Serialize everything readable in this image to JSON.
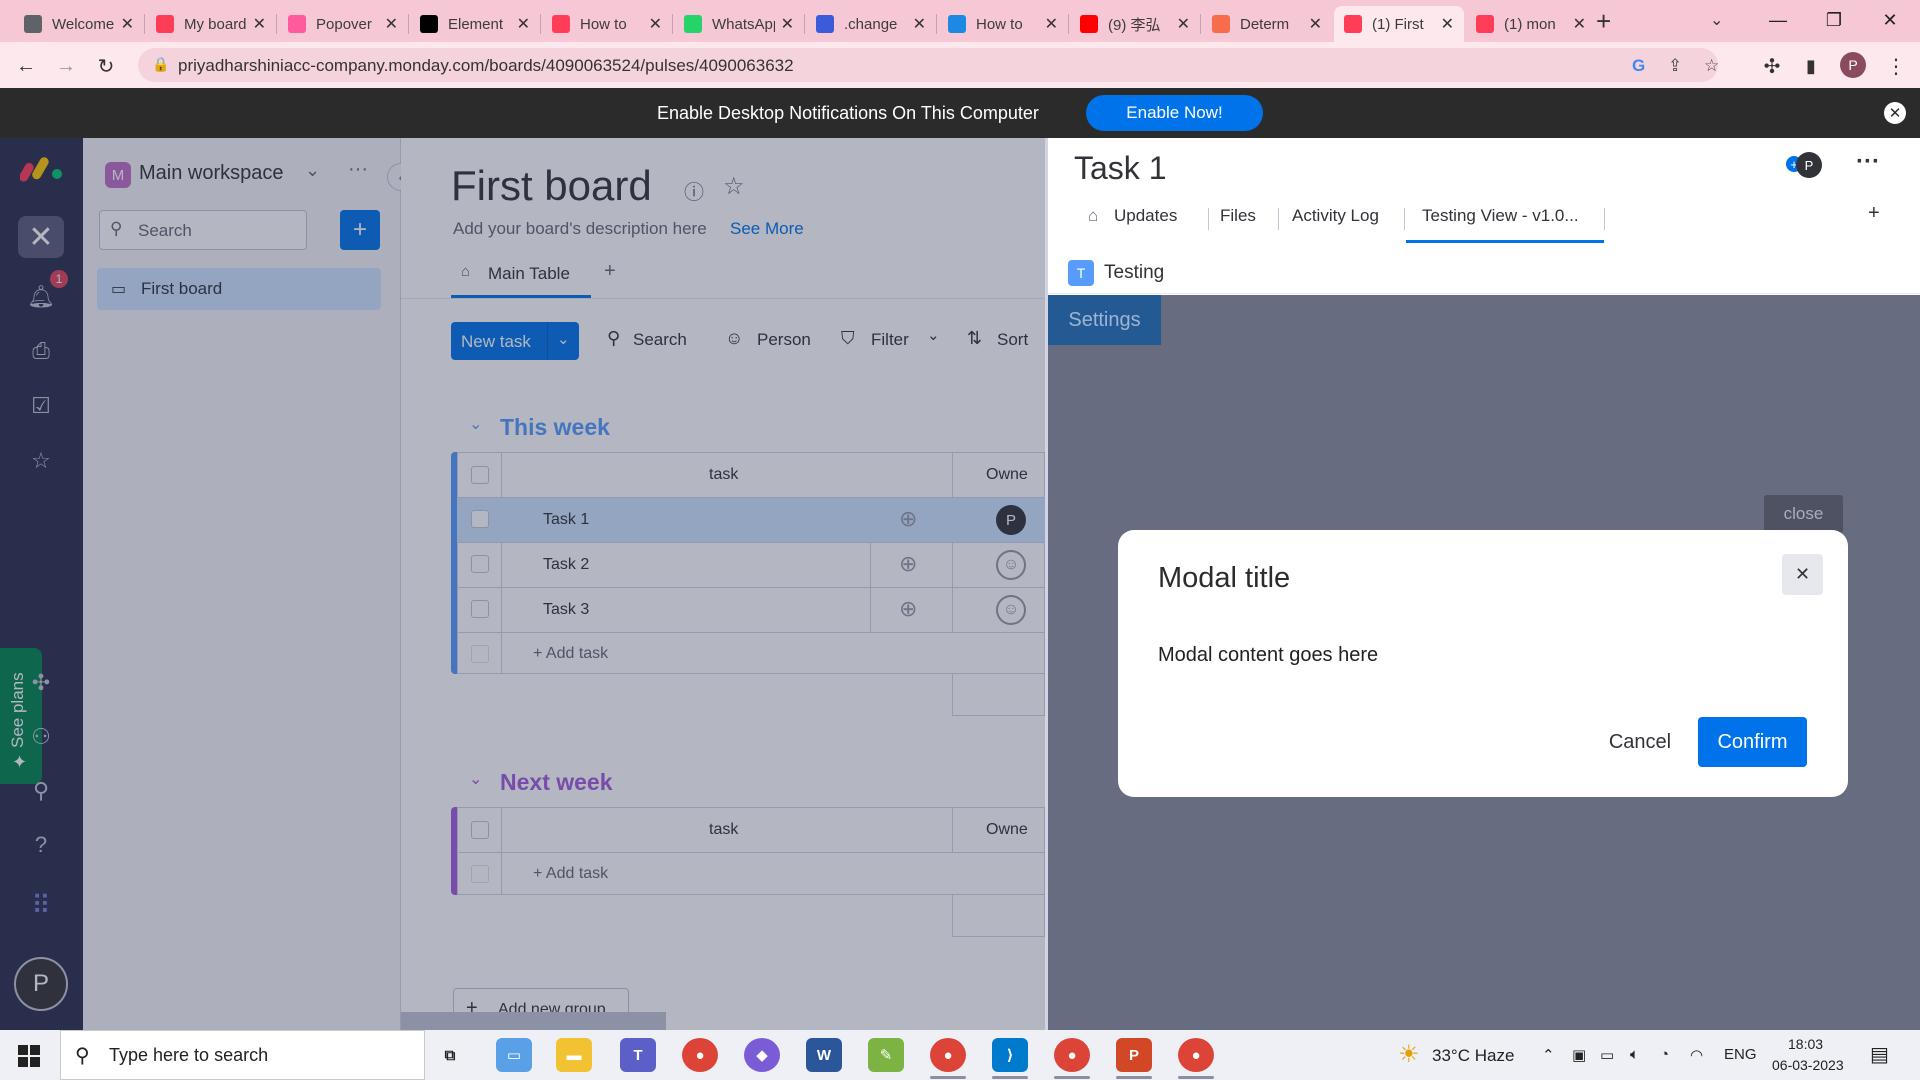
{
  "browser": {
    "tabs": [
      {
        "title": "Welcome",
        "color": "#5f6368"
      },
      {
        "title": "My board",
        "color": "#ff3d57"
      },
      {
        "title": "Popover",
        "color": "#ff5a9a"
      },
      {
        "title": "Element",
        "color": "#000000"
      },
      {
        "title": "How to",
        "color": "#ff3d57"
      },
      {
        "title": "WhatsApp",
        "color": "#25d366"
      },
      {
        "title": ".change",
        "color": "#3b5bdb"
      },
      {
        "title": "How to",
        "color": "#1e88e5"
      },
      {
        "title": "(9) 李弘",
        "color": "#ff0000"
      },
      {
        "title": "Determ",
        "color": "#f76c4a"
      },
      {
        "title": "(1) First",
        "color": "#ff3d57"
      },
      {
        "title": "(1) mon",
        "color": "#ff3d57"
      }
    ],
    "active_tab_index": 10,
    "url": "priyadharshiniacc-company.monday.com/boards/4090063524/pulses/4090063632",
    "profile_initial": "P"
  },
  "notification": {
    "text": "Enable Desktop Notifications On This Computer",
    "button": "Enable Now!"
  },
  "rail": {
    "notifications_count": "1",
    "see_plans": "See plans",
    "avatar_initial": "P"
  },
  "workspace": {
    "icon_letter": "M",
    "name": "Main workspace",
    "search_placeholder": "Search",
    "boards": [
      "First board"
    ]
  },
  "board": {
    "title": "First board",
    "description": "Add your board's description here",
    "see_more": "See More",
    "view_tab": "Main Table",
    "toolbar": {
      "new_task": "New task",
      "search": "Search",
      "person": "Person",
      "filter": "Filter",
      "sort": "Sort"
    },
    "groups": [
      {
        "title": "This week",
        "color": "#579bfc",
        "column_task": "task",
        "column_owner": "Owne",
        "rows": [
          "Task 1",
          "Task 2",
          "Task 3"
        ],
        "add_task": "+ Add task"
      },
      {
        "title": "Next week",
        "color": "#a25ddc",
        "column_task": "task",
        "column_owner": "Owne",
        "rows": [],
        "add_task": "+ Add task"
      }
    ],
    "owner_initial": "P",
    "add_group": "Add new group"
  },
  "panel": {
    "title": "Task 1",
    "avatar_initial": "P",
    "tabs": [
      "Updates",
      "Files",
      "Activity Log",
      "Testing View - v1.0..."
    ],
    "app_letter": "T",
    "app_name": "Testing",
    "settings_button": "Settings",
    "close_chip": "close"
  },
  "modal": {
    "title": "Modal title",
    "body": "Modal content goes here",
    "cancel": "Cancel",
    "confirm": "Confirm"
  },
  "taskbar": {
    "search_placeholder": "Type here to search",
    "weather": "33°C  Haze",
    "language": "ENG",
    "time": "18:03",
    "date": "06-03-2023"
  }
}
